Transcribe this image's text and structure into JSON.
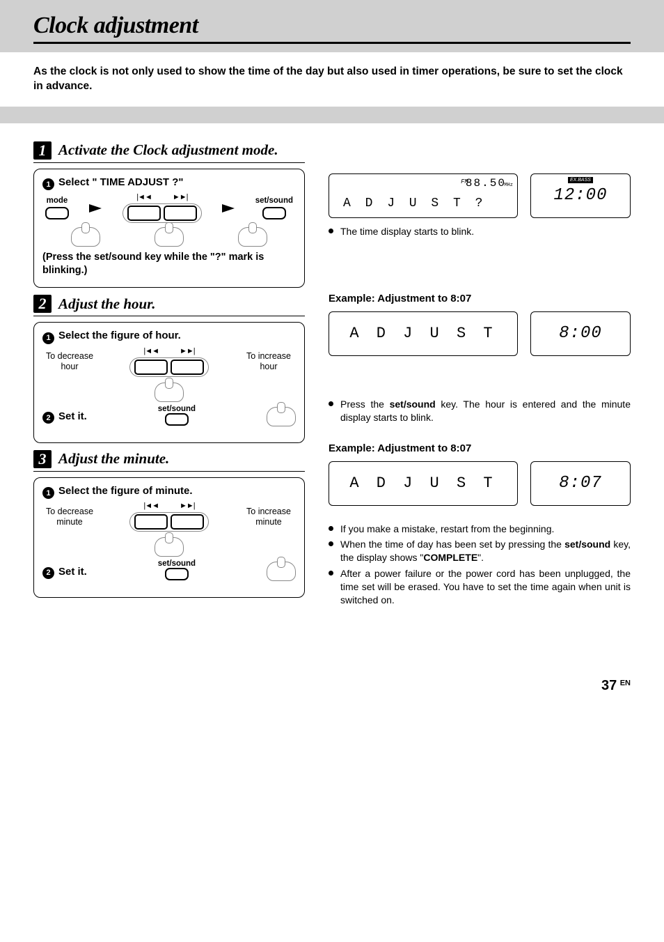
{
  "title": "Clock adjustment",
  "intro": "As the clock is not only used to show the time of the day but also used in timer operations, be sure to set the clock in advance.",
  "step1": {
    "title": "Activate the Clock adjustment mode.",
    "sub1": "Select \"  TIME ADJUST  ?\"",
    "labels": {
      "mode": "mode",
      "setsound": "set/sound"
    },
    "note": "(Press the set/sound key while the \"?\" mark is blinking.)",
    "display": {
      "freq": "88.50",
      "band": "FM",
      "units": "MHz",
      "text": "A D J U S T  ?",
      "time": "12:00",
      "badge": "EX.BASS"
    },
    "bullet": "The time display starts to blink."
  },
  "step2": {
    "title": "Adjust the hour.",
    "sub1": "Select the figure of hour.",
    "decrease": "To decrease hour",
    "increase": "To increase hour",
    "sub2": "Set it.",
    "setsound": "set/sound",
    "example": "Example: Adjustment to 8:07",
    "display": {
      "text": "A D J U S T",
      "time": "8:00"
    },
    "bullet_pre": "Press the ",
    "bullet_key": "set/sound",
    "bullet_post": " key. The hour is entered and the minute display starts to blink."
  },
  "step3": {
    "title": "Adjust the minute.",
    "sub1": "Select the figure of minute.",
    "decrease": "To decrease minute",
    "increase": "To increase minute",
    "sub2": "Set it.",
    "setsound": "set/sound",
    "example": "Example: Adjustment to 8:07",
    "display": {
      "text": "A D J U S T",
      "time": "8:07"
    },
    "bullets": {
      "b1": "If you make a mistake, restart from the beginning.",
      "b2_pre": "When the time of day has been set by pressing the ",
      "b2_key": "set/sound",
      "b2_mid": " key, the display shows \"",
      "b2_word": "COMPLETE",
      "b2_post": "\".",
      "b3": "After a power failure or the power cord has been unplugged, the time set will be erased. You have to set the time again when unit is switched on."
    }
  },
  "pagenum": "37",
  "lang": "EN",
  "icons": {
    "prev": "|◄◄",
    "next": "►►|"
  }
}
